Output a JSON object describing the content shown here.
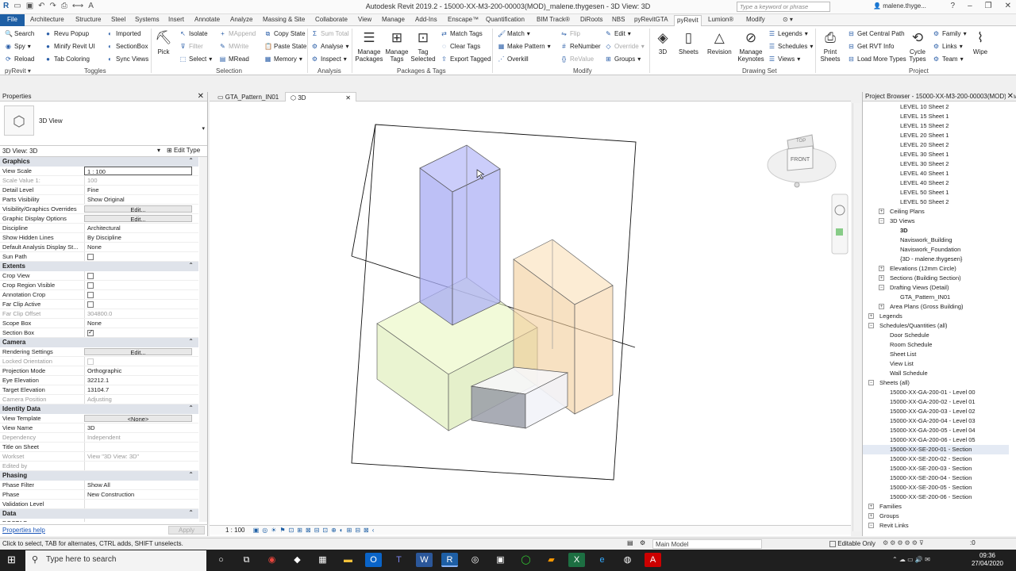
{
  "app": {
    "title": "Autodesk Revit 2019.2 - 15000-XX-M3-200-00003(MOD)_malene.thygesen - 3D View: 3D",
    "search_placeholder": "Type a keyword or phrase",
    "user": "malene.thyge..."
  },
  "tabs": [
    "File",
    "Architecture",
    "Structure",
    "Steel",
    "Systems",
    "Insert",
    "Annotate",
    "Analyze",
    "Massing & Site",
    "Collaborate",
    "View",
    "Manage",
    "Add-Ins",
    "Enscape™",
    "Quantification",
    "BIM Track®",
    "DiRoots",
    "NBS",
    "pyRevitGTA",
    "pyRevit",
    "Lumion®",
    "Modify"
  ],
  "ribbon": {
    "pyrevit": {
      "search": "Search",
      "spy": "Spy",
      "reload": "Reload",
      "revu_popup": "Revu Popup",
      "minify": "Minify Revit UI",
      "tab_coloring": "Tab Coloring",
      "imported": "Imported",
      "section_box": "SectionBox",
      "sync_views": "Sync Views",
      "panel_pyrevit": "pyRevit",
      "panel_toggles": "Toggles"
    },
    "selection": {
      "pick": "Pick",
      "isolate": "Isolate",
      "filter": "Filter",
      "select": "Select",
      "mappend": "MAppend",
      "mwrite": "MWrite",
      "mread": "MRead",
      "copy_state": "Copy State",
      "paste_state": "Paste State",
      "memory": "Memory",
      "panel": "Selection"
    },
    "analysis": {
      "sum_total": "Sum Total",
      "analyse": "Analyse",
      "inspect": "Inspect",
      "panel": "Analysis"
    },
    "packages": {
      "manage_packages": "Manage Packages",
      "manage_tags": "Manage Tags",
      "tag_selected": "Tag Selected",
      "match_tags": "Match Tags",
      "clear_tags": "Clear Tags",
      "export_tagged": "Export Tagged",
      "panel": "Packages & Tags"
    },
    "modify": {
      "match": "Match",
      "make_pattern": "Make Pattern",
      "overkill": "Overkill",
      "flip": "Flip",
      "renumber": "ReNumber",
      "revalue": "ReValue",
      "edit": "Edit",
      "override": "Override",
      "groups": "Groups",
      "panel": "Modify"
    },
    "drawing_set": {
      "three_d": "3D",
      "sheets": "Sheets",
      "revision": "Revision",
      "manage_keynotes": "Manage Keynotes",
      "legends": "Legends",
      "schedules": "Schedules",
      "views": "Views",
      "panel": "Drawing Set"
    },
    "project": {
      "print_sheets": "Print Sheets",
      "get_central_path": "Get Central Path",
      "get_rvt_info": "Get RVT Info",
      "load_more_types": "Load More Types",
      "cycle_types": "Cycle Types",
      "family": "Family",
      "links": "Links",
      "team": "Team",
      "wipe": "Wipe",
      "panel": "Project"
    }
  },
  "properties": {
    "title": "Properties",
    "type_name": "3D View",
    "selector": "3D View: 3D",
    "edit_type": "Edit Type",
    "groups": [
      {
        "name": "Graphics",
        "rows": [
          [
            "View Scale",
            "1 : 100",
            "edit"
          ],
          [
            "Scale Value    1:",
            "100",
            "grey"
          ],
          [
            "Detail Level",
            "Fine",
            ""
          ],
          [
            "Parts Visibility",
            "Show Original",
            ""
          ],
          [
            "Visibility/Graphics Overrides",
            "Edit...",
            "btn"
          ],
          [
            "Graphic Display Options",
            "Edit...",
            "btn"
          ],
          [
            "Discipline",
            "Architectural",
            ""
          ],
          [
            "Show Hidden Lines",
            "By Discipline",
            ""
          ],
          [
            "Default Analysis Display St...",
            "None",
            ""
          ],
          [
            "Sun Path",
            "",
            "chk"
          ]
        ]
      },
      {
        "name": "Extents",
        "rows": [
          [
            "Crop View",
            "",
            "chk"
          ],
          [
            "Crop Region Visible",
            "",
            "chk"
          ],
          [
            "Annotation Crop",
            "",
            "chk"
          ],
          [
            "Far Clip Active",
            "",
            "chk"
          ],
          [
            "Far Clip Offset",
            "304800.0",
            "grey"
          ],
          [
            "Scope Box",
            "None",
            ""
          ],
          [
            "Section Box",
            "",
            "chkon"
          ]
        ]
      },
      {
        "name": "Camera",
        "rows": [
          [
            "Rendering Settings",
            "Edit...",
            "btn"
          ],
          [
            "Locked Orientation",
            "",
            "greychk"
          ],
          [
            "Projection Mode",
            "Orthographic",
            ""
          ],
          [
            "Eye Elevation",
            "32212.1",
            ""
          ],
          [
            "Target Elevation",
            "13104.7",
            ""
          ],
          [
            "Camera Position",
            "Adjusting",
            "grey"
          ]
        ]
      },
      {
        "name": "Identity Data",
        "rows": [
          [
            "View Template",
            "<None>",
            "btn"
          ],
          [
            "View Name",
            "3D",
            ""
          ],
          [
            "Dependency",
            "Independent",
            "grey"
          ],
          [
            "Title on Sheet",
            "",
            ""
          ],
          [
            "Workset",
            "View \"3D View: 3D\"",
            "grey"
          ],
          [
            "Edited by",
            "",
            "grey"
          ]
        ]
      },
      {
        "name": "Phasing",
        "rows": [
          [
            "Phase Filter",
            "Show All",
            ""
          ],
          [
            "Phase",
            "New Construction",
            ""
          ],
          [
            "Validation Level",
            "",
            ""
          ]
        ]
      },
      {
        "name": "Data",
        "rows": [
          [
            "DOCTAG",
            "",
            ""
          ]
        ]
      }
    ],
    "help": "Properties help",
    "apply": "Apply"
  },
  "view_tabs": [
    "GTA_Pattern_IN01",
    "3D"
  ],
  "view_scale": "1 : 100",
  "viewcube": {
    "top": "TOP",
    "front": "FRONT"
  },
  "browser": {
    "title": "Project Browser - 15000-XX-M3-200-00003(MOD)_malene.thygesen",
    "items": [
      {
        "t": "LEVEL 10 Sheet 2",
        "i": 3
      },
      {
        "t": "LEVEL 15 Sheet 1",
        "i": 3
      },
      {
        "t": "LEVEL 15 Sheet 2",
        "i": 3
      },
      {
        "t": "LEVEL 20 Sheet 1",
        "i": 3
      },
      {
        "t": "LEVEL 20 Sheet 2",
        "i": 3
      },
      {
        "t": "LEVEL 30 Sheet 1",
        "i": 3
      },
      {
        "t": "LEVEL 30 Sheet 2",
        "i": 3
      },
      {
        "t": "LEVEL 40 Sheet 1",
        "i": 3
      },
      {
        "t": "LEVEL 40 Sheet 2",
        "i": 3
      },
      {
        "t": "LEVEL 50 Sheet 1",
        "i": 3
      },
      {
        "t": "LEVEL 50 Sheet 2",
        "i": 3
      },
      {
        "t": "Ceiling Plans",
        "i": 2,
        "e": "+"
      },
      {
        "t": "3D Views",
        "i": 2,
        "e": "−"
      },
      {
        "t": "3D",
        "i": 3,
        "b": true
      },
      {
        "t": "Naviswork_Building",
        "i": 3
      },
      {
        "t": "Naviswork_Foundation",
        "i": 3
      },
      {
        "t": "{3D - malene.thygesen}",
        "i": 3
      },
      {
        "t": "Elevations (12mm Circle)",
        "i": 2,
        "e": "+"
      },
      {
        "t": "Sections (Building Section)",
        "i": 2,
        "e": "+"
      },
      {
        "t": "Drafting Views (Detail)",
        "i": 2,
        "e": "−"
      },
      {
        "t": "GTA_Pattern_IN01",
        "i": 3
      },
      {
        "t": "Area Plans (Gross Building)",
        "i": 2,
        "e": "+"
      },
      {
        "t": "Legends",
        "i": 1,
        "e": "+"
      },
      {
        "t": "Schedules/Quantities (all)",
        "i": 1,
        "e": "−"
      },
      {
        "t": "Door Schedule",
        "i": 2
      },
      {
        "t": "Room Schedule",
        "i": 2
      },
      {
        "t": "Sheet List",
        "i": 2
      },
      {
        "t": "View List",
        "i": 2
      },
      {
        "t": "Wall Schedule",
        "i": 2
      },
      {
        "t": "Sheets (all)",
        "i": 1,
        "e": "−"
      },
      {
        "t": "15000-XX-GA-200-01 - Level 00",
        "i": 2
      },
      {
        "t": "15000-XX-GA-200-02 - Level 01",
        "i": 2
      },
      {
        "t": "15000-XX-GA-200-03 - Level 02",
        "i": 2
      },
      {
        "t": "15000-XX-GA-200-04 - Level 03",
        "i": 2
      },
      {
        "t": "15000-XX-GA-200-05 - Level 04",
        "i": 2
      },
      {
        "t": "15000-XX-GA-200-06 - Level 05",
        "i": 2
      },
      {
        "t": "15000-XX-SE-200-01 - Section",
        "i": 2,
        "h": true
      },
      {
        "t": "15000-XX-SE-200-02 - Section",
        "i": 2
      },
      {
        "t": "15000-XX-SE-200-03 - Section",
        "i": 2
      },
      {
        "t": "15000-XX-SE-200-04 - Section",
        "i": 2
      },
      {
        "t": "15000-XX-SE-200-05 - Section",
        "i": 2
      },
      {
        "t": "15000-XX-SE-200-06 - Section",
        "i": 2
      },
      {
        "t": "Families",
        "i": 1,
        "e": "+"
      },
      {
        "t": "Groups",
        "i": 1,
        "e": "+"
      },
      {
        "t": "Revit Links",
        "i": 1,
        "e": "−"
      }
    ]
  },
  "status": {
    "hint": "Click to select, TAB for alternates, CTRL adds, SHIFT unselects.",
    "model": "Main Model",
    "editable": "Editable Only",
    "count": ":0"
  },
  "taskbar": {
    "search": "Type here to search",
    "time": "09:36",
    "date": "27/04/2020"
  },
  "colors": {
    "accent": "#1e5fa5",
    "blue_mass": "#a9aef5",
    "green_mass": "#e2f2b4",
    "orange_mass": "#f6d7ac"
  }
}
